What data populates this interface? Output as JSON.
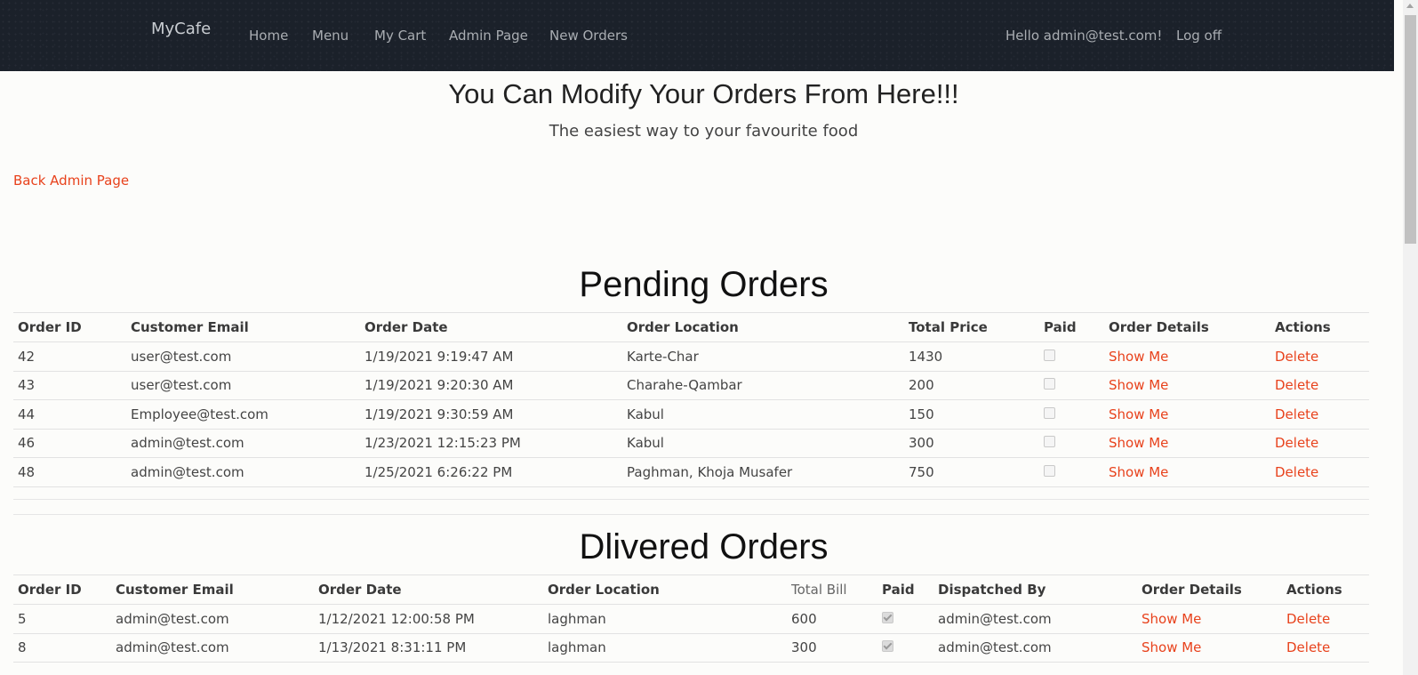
{
  "nav": {
    "brand": "MyCafe",
    "links": [
      "Home",
      "Menu",
      "My Cart",
      "Admin Page",
      "New Orders"
    ],
    "greeting": "Hello admin@test.com!",
    "logoff": "Log off"
  },
  "header": {
    "title": "You Can Modify Your Orders From Here!!!",
    "subtitle": "The easiest way to your favourite food"
  },
  "back_link": "Back Admin Page",
  "pending": {
    "title": "Pending Orders",
    "columns": [
      "Order ID",
      "Customer Email",
      "Order Date",
      "Order Location",
      "Total Price",
      "Paid",
      "Order Details",
      "Actions"
    ],
    "rows": [
      {
        "id": "42",
        "email": "user@test.com",
        "date": "1/19/2021 9:19:47 AM",
        "location": "Karte-Char",
        "total": "1430",
        "paid": false,
        "details": "Show Me",
        "action": "Delete"
      },
      {
        "id": "43",
        "email": "user@test.com",
        "date": "1/19/2021 9:20:30 AM",
        "location": "Charahe-Qambar",
        "total": "200",
        "paid": false,
        "details": "Show Me",
        "action": "Delete"
      },
      {
        "id": "44",
        "email": "Employee@test.com",
        "date": "1/19/2021 9:30:59 AM",
        "location": "Kabul",
        "total": "150",
        "paid": false,
        "details": "Show Me",
        "action": "Delete"
      },
      {
        "id": "46",
        "email": "admin@test.com",
        "date": "1/23/2021 12:15:23 PM",
        "location": "Kabul",
        "total": "300",
        "paid": false,
        "details": "Show Me",
        "action": "Delete"
      },
      {
        "id": "48",
        "email": "admin@test.com",
        "date": "1/25/2021 6:26:22 PM",
        "location": "Paghman, Khoja Musafer",
        "total": "750",
        "paid": false,
        "details": "Show Me",
        "action": "Delete"
      }
    ]
  },
  "delivered": {
    "title": "Dlivered Orders",
    "columns": [
      "Order ID",
      "Customer Email",
      "Order Date",
      "Order Location",
      "Total Bill",
      "Paid",
      "Dispatched By",
      "Order Details",
      "Actions"
    ],
    "rows": [
      {
        "id": "5",
        "email": "admin@test.com",
        "date": "1/12/2021 12:00:58 PM",
        "location": "laghman",
        "total": "600",
        "paid": true,
        "dispatched": "admin@test.com",
        "details": "Show Me",
        "action": "Delete"
      },
      {
        "id": "8",
        "email": "admin@test.com",
        "date": "1/13/2021 8:31:11 PM",
        "location": "laghman",
        "total": "300",
        "paid": true,
        "dispatched": "admin@test.com",
        "details": "Show Me",
        "action": "Delete"
      }
    ]
  },
  "colors": {
    "navbar_bg": "#1b212a",
    "link_accent": "#e8421c"
  }
}
